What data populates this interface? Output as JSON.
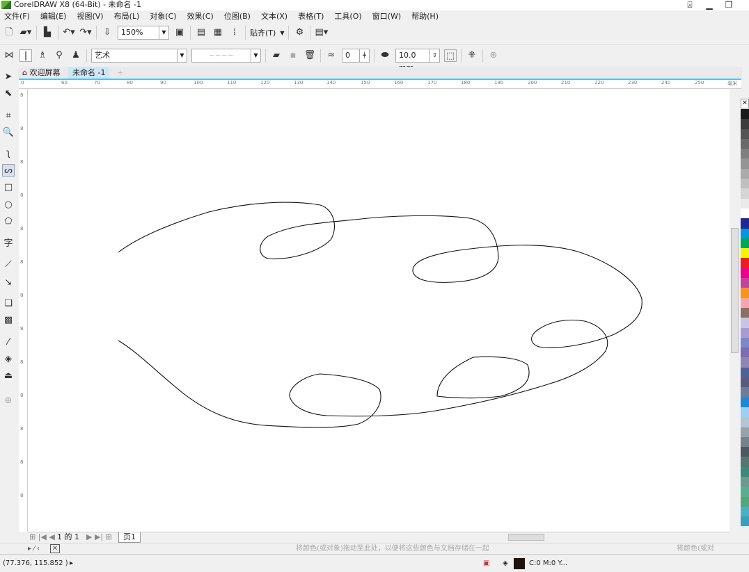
{
  "window": {
    "title": "CorelDRAW X8 (64-Bit) - 未命名 -1"
  },
  "menu": [
    "文件(F)",
    "编辑(E)",
    "视图(V)",
    "布局(L)",
    "对象(C)",
    "效果(C)",
    "位图(B)",
    "文本(X)",
    "表格(T)",
    "工具(O)",
    "窗口(W)",
    "帮助(H)"
  ],
  "toolbar": {
    "zoom": "150%",
    "snap": "贴齐(T)"
  },
  "property_bar": {
    "preset": "艺术",
    "stroke_smoothing": "0",
    "width": "10.0 mm"
  },
  "tabs": [
    {
      "label": "欢迎屏幕",
      "active": false
    },
    {
      "label": "未命名 -1",
      "active": true
    }
  ],
  "ruler": {
    "h_labels": [
      "0",
      "60",
      "70",
      "80",
      "90",
      "100",
      "110",
      "120",
      "130",
      "140",
      "150",
      "160",
      "170",
      "180",
      "190",
      "200",
      "210",
      "220",
      "230",
      "240",
      "250"
    ],
    "unit": "毫米",
    "v_labels": [
      "8",
      "8",
      "8",
      "8",
      "8",
      "8",
      "8",
      "8",
      "8",
      "8",
      "8",
      "8",
      "8"
    ]
  },
  "pagebar": {
    "page_of": "1 的 1",
    "page_tab": "页1"
  },
  "doc_palette": {
    "hint": "将颜色(或对象)拖动至此处，以便将这些颜色与文档存储在一起",
    "hint_right": "将颜色(或对"
  },
  "status": {
    "coords": "(77.376, 115.852 )",
    "fill": "C:0 M:0 Y..."
  },
  "colors": {
    "accent": "#55c1ea",
    "fill_swatch": "#1e140c"
  },
  "palette": [
    "#1a1a1a",
    "#3c3c3c",
    "#555555",
    "#6a6a6a",
    "#7f7f7f",
    "#959595",
    "#aaaaaa",
    "#c0c0c0",
    "#d5d5d5",
    "#eaeaea",
    "#ffffff",
    "#1d2a8f",
    "#0096e0",
    "#00a650",
    "#fff200",
    "#ed1c24",
    "#ec008c",
    "#c0449a",
    "#f7941d",
    "#f4a6b0",
    "#8a7164",
    "#cbc3e3",
    "#a99bd0",
    "#7b88c9",
    "#7b6cb5",
    "#8f86b3",
    "#4a6496",
    "#5c5a7e",
    "#6b7e96",
    "#1e8ad6",
    "#9dd0f0",
    "#b3c5d3",
    "#96a3ad",
    "#76838c",
    "#4d5961",
    "#56756f",
    "#3c8a78",
    "#6b9a8f",
    "#5aad92",
    "#52a87a",
    "#4bb0c4",
    "#3b9fb6"
  ]
}
